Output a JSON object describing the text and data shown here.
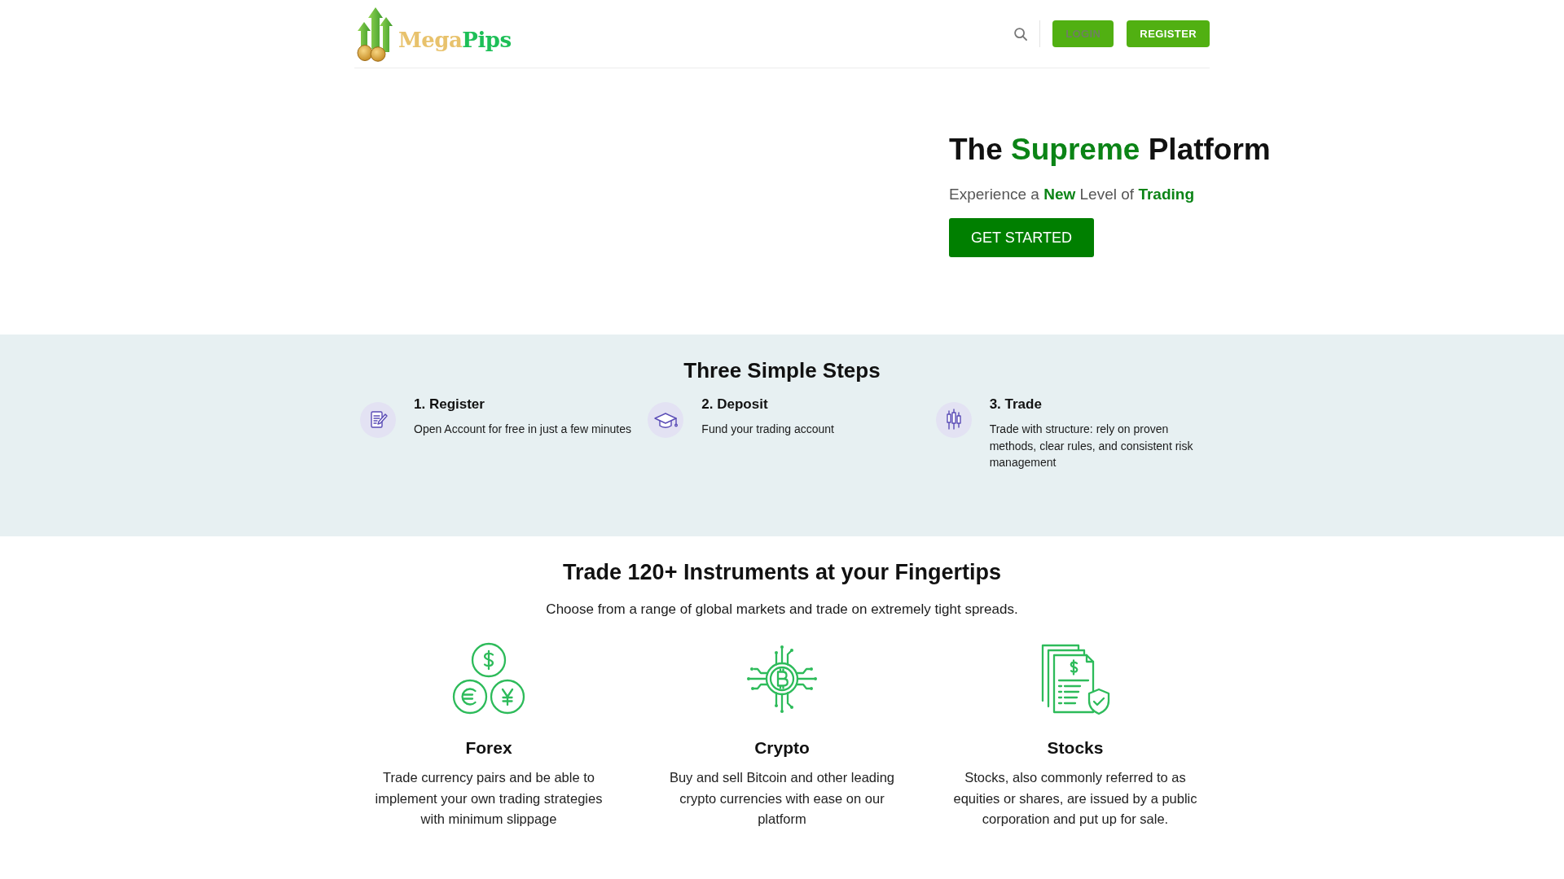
{
  "header": {
    "logo": {
      "text_parts": [
        "Mega",
        "Pips"
      ]
    },
    "buttons": [
      {
        "label": "LOGIN",
        "disabled": true
      },
      {
        "label": "REGISTER",
        "disabled": false
      }
    ]
  },
  "hero": {
    "title": [
      {
        "text": "The ",
        "highlight": false
      },
      {
        "text": "Supreme",
        "highlight": true
      },
      {
        "text": " Platform",
        "highlight": false
      }
    ],
    "subtitle": [
      {
        "text": "Experience a ",
        "highlight": false
      },
      {
        "text": "New",
        "highlight": true
      },
      {
        "text": " Level of ",
        "highlight": false
      },
      {
        "text": "Trading",
        "highlight": true
      }
    ],
    "button": "GET STARTED"
  },
  "steps": {
    "title": "Three Simple Steps",
    "items": [
      {
        "title": "1. Register",
        "text": "Open Account for free in just a few minutes"
      },
      {
        "title": "2. Deposit",
        "text": "Fund your trading account"
      },
      {
        "title": "3. Trade",
        "text": "Trade with structure: rely on proven methods, clear rules, and consistent risk management"
      }
    ]
  },
  "instruments": {
    "title": "Trade 120+ Instruments at your Fingertips",
    "subtitle": "Choose from a range of global markets and trade on extremely tight spreads.",
    "items": [
      {
        "title": "Forex",
        "text": "Trade currency pairs and be able to implement your own trading strategies with minimum slippage"
      },
      {
        "title": "Crypto",
        "text": "Buy and sell Bitcoin and other leading crypto currencies with ease on our platform"
      },
      {
        "title": "Stocks",
        "text": "Stocks, also commonly referred to as equities or shares, are issued by a public corporation and put up for sale."
      }
    ]
  }
}
